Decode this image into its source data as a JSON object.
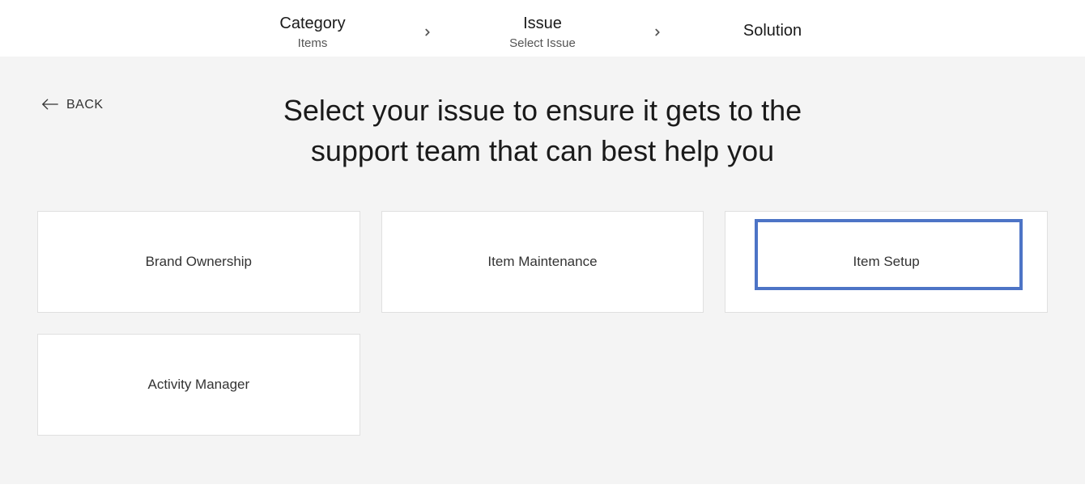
{
  "breadcrumb": {
    "steps": [
      {
        "title": "Category",
        "subtitle": "Items"
      },
      {
        "title": "Issue",
        "subtitle": "Select Issue"
      },
      {
        "title": "Solution",
        "subtitle": ""
      }
    ]
  },
  "back": {
    "label": "BACK"
  },
  "heading": "Select your issue to ensure it gets to the support team that can best help you",
  "issues": [
    {
      "label": "Brand Ownership"
    },
    {
      "label": "Item Maintenance"
    },
    {
      "label": "Item Setup"
    },
    {
      "label": "Activity Manager"
    }
  ],
  "highlighted_index": 2
}
